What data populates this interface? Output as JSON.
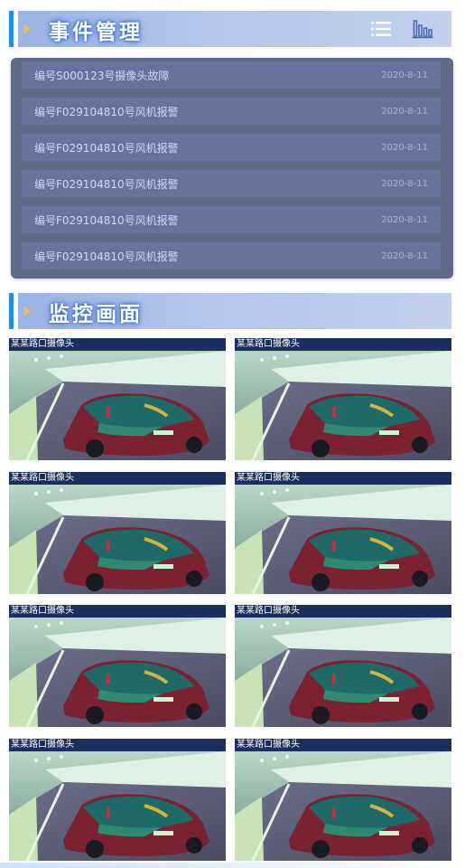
{
  "events_section": {
    "title": "事件管理",
    "icons": [
      "list-icon",
      "bar-chart-icon"
    ]
  },
  "events": [
    {
      "title": "编号S000123号摄像头故障",
      "date": "2020-8-11"
    },
    {
      "title": "编号F029104810号风机报警",
      "date": "2020-8-11"
    },
    {
      "title": "编号F029104810号风机报警",
      "date": "2020-8-11"
    },
    {
      "title": "编号F029104810号风机报警",
      "date": "2020-8-11"
    },
    {
      "title": "编号F029104810号风机报警",
      "date": "2020-8-11"
    },
    {
      "title": "编号F029104810号风机报警",
      "date": "2020-8-11"
    }
  ],
  "monitor_section": {
    "title": "监控画面"
  },
  "cameras": [
    {
      "label": "某某路口摄像头"
    },
    {
      "label": "某某路口摄像头"
    },
    {
      "label": "某某路口摄像头"
    },
    {
      "label": "某某路口摄像头"
    },
    {
      "label": "某某路口摄像头"
    },
    {
      "label": "某某路口摄像头"
    },
    {
      "label": "某某路口摄像头"
    },
    {
      "label": "某某路口摄像头"
    }
  ],
  "colors": {
    "accent": "#1e8fe6",
    "header_gradient_start": "#9db4e3",
    "panel_bg": "#5f6a84",
    "row_bg": "#68749a",
    "camera_label_bg": "#1a2f5e",
    "arrow": "#f6c03a"
  }
}
